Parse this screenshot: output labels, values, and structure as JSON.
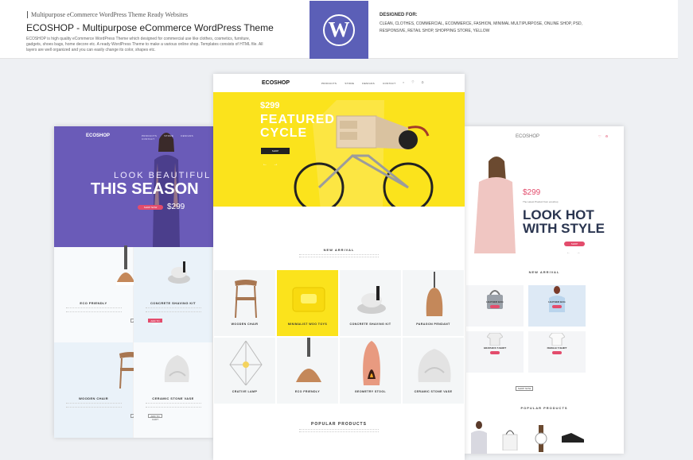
{
  "header": {
    "kicker": "Multipurpose eCommerce WordPress Theme Ready Websites",
    "title": "ECOSHOP - Multipurpose eCommerce WordPress Theme",
    "description": "ECOSHOP is high quality eCommerce WordPress Theme which designed for commercial use like clothes, cosmetics, furniture, gadgets, shoes bags, home decore etc. A ready WordPress Theme to make a various online shop. Templates consists of HTML file. All layers are well organized and you can easily change its color, shapes etc.",
    "wp_logo": "W",
    "designed_for_label": "DESIGNED FOR:",
    "designed_for_tags": "CLEAN, CLOTHES, COMMERCIAL, ECOMMERCE, FASHION, MINIMAL MULTIPURPOSE, ONLINE SHOP, PSD, RESPONSIVE, RETAIL SHOP, SHOPPING STORE, YELLOW"
  },
  "colors": {
    "purple": "#6a5bb8",
    "wp_purple": "#5b5fb7",
    "yellow": "#fbe31c",
    "pink": "#e34c6c",
    "navy": "#2a3550"
  },
  "left_preview": {
    "logo": "ECOSHOP",
    "nav": "PRODUCTS STORE DESIGNS CONTACT",
    "hero_line1": "LOOK BEAUTIFUL",
    "hero_line2": "THIS SEASON",
    "hero_button": "SHOP NOW",
    "hero_price": "$299",
    "products": [
      {
        "name": "ECO FRIENDLY",
        "button": "ADD TO CART"
      },
      {
        "name": "CONCRETE SHAVING KIT",
        "button": "ADD TO CART"
      },
      {
        "name": "WOODEN CHAIR",
        "button": "ADD TO CART"
      },
      {
        "name": "CERAMIC STONE VASE",
        "button": "ADD TO CART"
      }
    ]
  },
  "center_preview": {
    "logo": "ECOSHOP",
    "nav": "PRODUCTS STORE DESIGNS CONTACT",
    "icons": "⌕ ♡ ⚙",
    "hero_price": "$299",
    "hero_line1": "FEATURED",
    "hero_line2": "CYCLE",
    "hero_button": "SHOP",
    "hero_arrows": "← →",
    "new_arrival": "NEW ARRIVAL",
    "products": [
      {
        "name": "WOODEN CHAIR"
      },
      {
        "name": "MINIMALIST WOO TOYS"
      },
      {
        "name": "CONCRETE SHAVING KIT"
      },
      {
        "name": "PARAGON PENDANT"
      },
      {
        "name": "CRATIVE LAMP"
      },
      {
        "name": "ECO FRIENDLY"
      },
      {
        "name": "GEOMETRY STOOL"
      },
      {
        "name": "CERAMIC STONE VASE"
      }
    ],
    "popular_products": "POPULAR PRODUCTS"
  },
  "right_preview": {
    "logo": "ECOSHOP",
    "icons": "♡ ⚙",
    "hero_price": "$299",
    "hero_sub": "The Latest Product from ecoshop",
    "hero_line1": "LOOK HOT",
    "hero_line2": "WITH STYLE",
    "hero_button": "SHOP",
    "hero_arrows": "← →",
    "new_arrival": "NEW ARRIVAL",
    "products": [
      {
        "name": "LEATHER BAG"
      },
      {
        "name": "LEATHER BAG"
      },
      {
        "name": "GRAPHICS T-SHIRT"
      },
      {
        "name": "FEMALE T-SHIRT"
      }
    ],
    "shop_now": "SHOP NOW",
    "popular_products": "POPULAR PRODUCTS"
  }
}
